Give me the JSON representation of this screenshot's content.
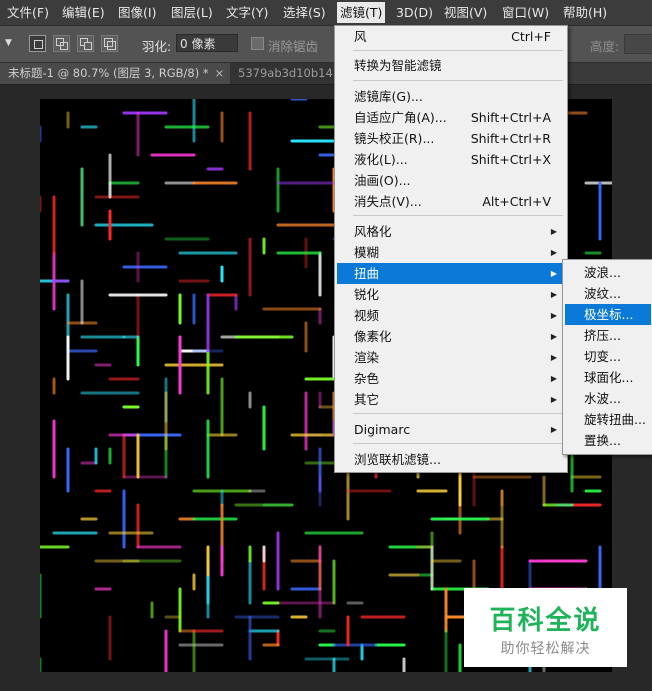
{
  "menubar": {
    "items": [
      {
        "label": "文件(F)"
      },
      {
        "label": "编辑(E)"
      },
      {
        "label": "图像(I)"
      },
      {
        "label": "图层(L)"
      },
      {
        "label": "文字(Y)"
      },
      {
        "label": "选择(S)"
      },
      {
        "label": "滤镜(T)"
      },
      {
        "label": "3D(D)"
      },
      {
        "label": "视图(V)"
      },
      {
        "label": "窗口(W)"
      },
      {
        "label": "帮助(H)"
      }
    ],
    "active_index": 6
  },
  "options": {
    "feather_label": "羽化:",
    "feather_value": "0 像素",
    "antialias_label": "消除锯齿",
    "height_label": "高度:"
  },
  "tabs": [
    {
      "label": "未标题-1 @ 80.7% (图层 3, RGB/8) *",
      "close": "×"
    },
    {
      "label": "5379ab3d10b14..."
    }
  ],
  "filter_menu": {
    "items": [
      {
        "label": "风",
        "shortcut": "Ctrl+F"
      },
      {
        "label": "转换为智能滤镜"
      },
      {
        "label": "滤镜库(G)..."
      },
      {
        "label": "自适应广角(A)...",
        "shortcut": "Shift+Ctrl+A"
      },
      {
        "label": "镜头校正(R)...",
        "shortcut": "Shift+Ctrl+R"
      },
      {
        "label": "液化(L)...",
        "shortcut": "Shift+Ctrl+X"
      },
      {
        "label": "油画(O)..."
      },
      {
        "label": "消失点(V)...",
        "shortcut": "Alt+Ctrl+V"
      },
      {
        "label": "风格化",
        "submenu": true
      },
      {
        "label": "模糊",
        "submenu": true
      },
      {
        "label": "扭曲",
        "submenu": true,
        "highlighted": true
      },
      {
        "label": "锐化",
        "submenu": true
      },
      {
        "label": "视频",
        "submenu": true
      },
      {
        "label": "像素化",
        "submenu": true
      },
      {
        "label": "渲染",
        "submenu": true
      },
      {
        "label": "杂色",
        "submenu": true
      },
      {
        "label": "其它",
        "submenu": true
      },
      {
        "label": "Digimarc",
        "submenu": true
      },
      {
        "label": "浏览联机滤镜..."
      }
    ]
  },
  "distort_menu": {
    "items": [
      {
        "label": "波浪..."
      },
      {
        "label": "波纹..."
      },
      {
        "label": "极坐标...",
        "highlighted": true
      },
      {
        "label": "挤压..."
      },
      {
        "label": "切变..."
      },
      {
        "label": "球面化..."
      },
      {
        "label": "水波..."
      },
      {
        "label": "旋转扭曲..."
      },
      {
        "label": "置换..."
      }
    ]
  },
  "watermark": {
    "title": "百科全说",
    "subtitle": "助你轻松解决"
  },
  "colors": {
    "menu_highlight": "#0a79d7",
    "menubar_bg": "#3c3c3c",
    "options_bg": "#535353",
    "canvas_bg": "#000000",
    "workspace_bg": "#282828",
    "watermark_green": "#1fb35a"
  },
  "icons": {
    "submenu_arrow": "triangle-right-icon",
    "tool_dropdown": "caret-down-icon"
  }
}
